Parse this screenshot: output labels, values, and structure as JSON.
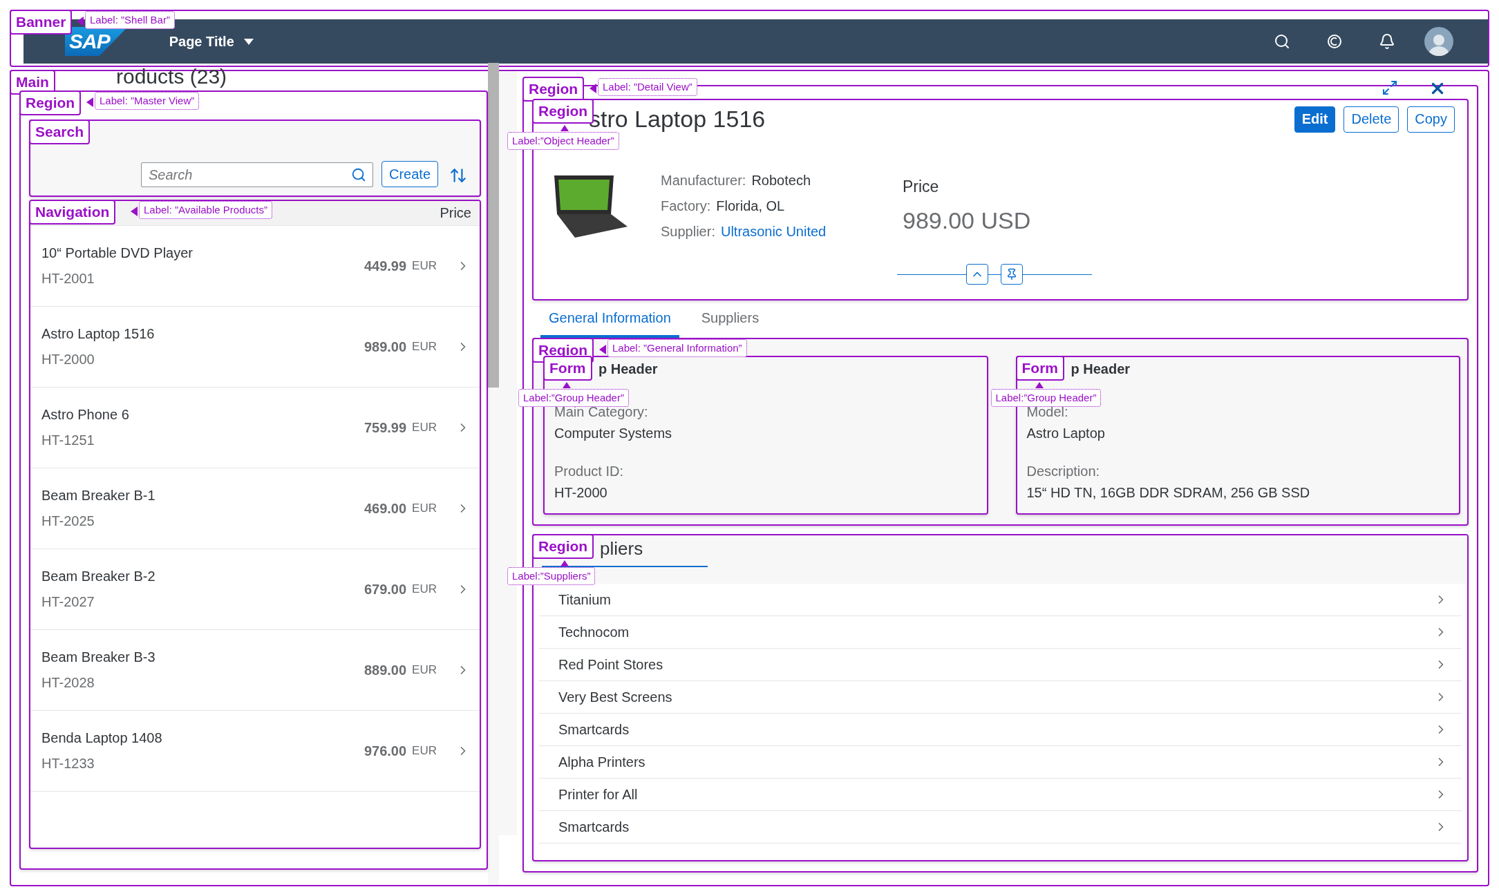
{
  "banner": {
    "landmark": "Banner",
    "label": "Label: ”Shell Bar”",
    "logo": "SAP",
    "title": "Page Title"
  },
  "main": {
    "landmark": "Main",
    "title": "roducts (23)",
    "master": {
      "landmark": "Region",
      "label": "Label: ”Master View”",
      "search": {
        "landmark": "Search",
        "placeholder": "Search",
        "create": "Create"
      },
      "navigation": {
        "landmark": "Navigation",
        "label": "Label: ”Available Products”",
        "column": "Price",
        "items": [
          {
            "name": "10“ Portable DVD Player",
            "id": "HT-2001",
            "price": "449.99",
            "currency": "EUR"
          },
          {
            "name": "Astro Laptop 1516",
            "id": "HT-2000",
            "price": "989.00",
            "currency": "EUR"
          },
          {
            "name": "Astro Phone 6",
            "id": "HT-1251",
            "price": "759.99",
            "currency": "EUR"
          },
          {
            "name": "Beam Breaker B-1",
            "id": "HT-2025",
            "price": "469.00",
            "currency": "EUR"
          },
          {
            "name": "Beam Breaker B-2",
            "id": "HT-2027",
            "price": "679.00",
            "currency": "EUR"
          },
          {
            "name": "Beam Breaker B-3",
            "id": "HT-2028",
            "price": "889.00",
            "currency": "EUR"
          },
          {
            "name": "Benda Laptop 1408",
            "id": "HT-1233",
            "price": "976.00",
            "currency": "EUR"
          }
        ]
      }
    },
    "detail": {
      "landmark": "Region",
      "label": "Label: ”Detail View”",
      "header": {
        "landmark": "Region",
        "label": "Label:”Object Header”",
        "title": "stro Laptop 1516",
        "actions": [
          {
            "label": "Edit",
            "kind": "emphasized"
          },
          {
            "label": "Delete",
            "kind": "default"
          },
          {
            "label": "Copy",
            "kind": "default"
          }
        ],
        "attributes": [
          {
            "label": "Manufacturer:",
            "value": "Robotech",
            "kind": "text"
          },
          {
            "label": "Factory:",
            "value": "Florida, OL",
            "kind": "text"
          },
          {
            "label": "Supplier:",
            "value": "Ultrasonic United",
            "kind": "link"
          }
        ],
        "price_label": "Price",
        "price": "989.00 USD"
      },
      "tabs": [
        {
          "label": "General Information",
          "selected": true
        },
        {
          "label": "Suppliers",
          "selected": false
        }
      ],
      "general": {
        "landmark": "Region",
        "label": "Label: ”General Information”",
        "forms": [
          {
            "landmark": "Form",
            "label": "Label:”Group Header”",
            "title": "p Header",
            "fields": [
              {
                "label": "Main Category:",
                "value": "Computer Systems"
              },
              {
                "label": "Product ID:",
                "value": "HT-2000"
              }
            ]
          },
          {
            "landmark": "Form",
            "label": "Label:”Group Header”",
            "title": "p Header",
            "fields": [
              {
                "label": "Model:",
                "value": "Astro Laptop"
              },
              {
                "label": "Description:",
                "value": "15“ HD TN, 16GB DDR SDRAM, 256 GB SSD"
              }
            ]
          }
        ]
      },
      "suppliers": {
        "landmark": "Region",
        "label": "Label:”Suppliers”",
        "title": "pliers",
        "items": [
          "Titanium",
          "Technocom",
          "Red Point Stores",
          "Very Best Screens",
          "Smartcards",
          "Alpha Printers",
          "Printer for All",
          "Smartcards"
        ]
      }
    }
  }
}
